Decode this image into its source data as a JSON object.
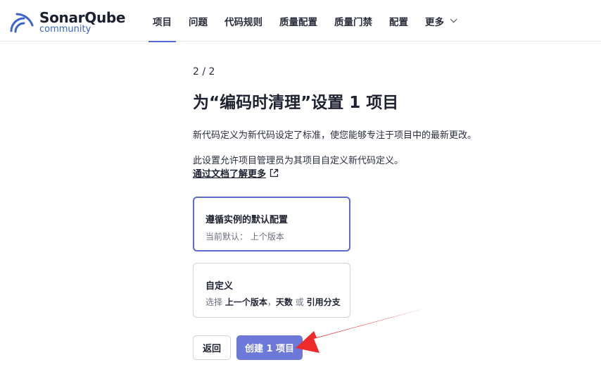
{
  "brand": {
    "name_part1": "Sonar",
    "name_part2": "Qube",
    "edition": "community"
  },
  "nav": {
    "items": [
      {
        "label": "项目",
        "active": true
      },
      {
        "label": "问题"
      },
      {
        "label": "代码规则"
      },
      {
        "label": "质量配置"
      },
      {
        "label": "质量门禁"
      },
      {
        "label": "配置"
      },
      {
        "label": "更多"
      }
    ]
  },
  "main": {
    "step": "2 / 2",
    "title": "为“编码时清理”设置 1 项目",
    "paragraph1": "新代码定义为新代码设定了标准，使您能够专注于项目中的最新更改。",
    "paragraph2": "此设置允许项目管理员为其项目自定义新代码定义。",
    "doc_link": "通过文档了解更多",
    "options": [
      {
        "title": "遵循实例的默认配置",
        "sub_prefix": "当前默认：",
        "sub_value": "上个版本",
        "selected": true
      },
      {
        "title": "自定义",
        "sub_prefix": "选择",
        "sub_b1": "上一个版本",
        "sub_sep1": "，",
        "sub_b2": "天数",
        "sub_sep2": "或",
        "sub_b3": "引用分支",
        "selected": false
      }
    ],
    "back_label": "返回",
    "create_label": "创建 1 项目"
  },
  "colors": {
    "accent": "#5469d4",
    "primary_button": "#6c79d9",
    "annotation_arrow": "#ee2b2b"
  },
  "icons": {
    "logo": "sonar-waves-icon",
    "external_link": "external-link-icon",
    "more_chevron": "chevron-down-icon"
  }
}
